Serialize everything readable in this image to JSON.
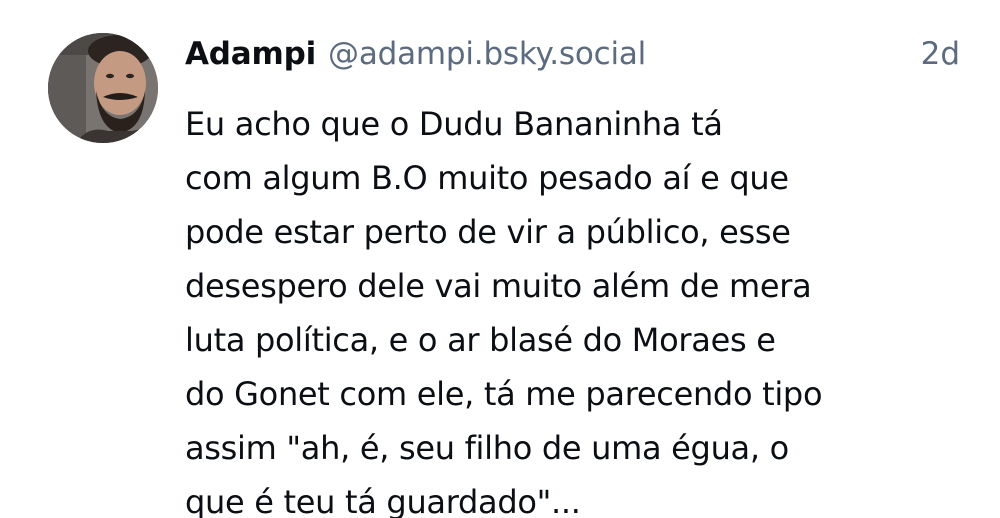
{
  "post": {
    "author": {
      "display_name": "Adampi",
      "handle": "@adampi.bsky.social",
      "avatar_icon": "user-avatar-photo"
    },
    "timestamp": "2d",
    "text_lines": [
      "Eu acho que o Dudu Bananinha tá",
      "com algum B.O muito pesado aí e que",
      "pode estar perto de vir a público, esse",
      "desespero dele vai muito além de mera",
      "luta política, e o ar blasé do Moraes e",
      "do Gonet com ele, tá me parecendo tipo",
      "assim \"ah, é, seu filho de uma égua, o",
      "que é teu tá guardado\"..."
    ]
  },
  "colors": {
    "background": "#ffffff",
    "text_primary": "#0b0f14",
    "text_secondary": "#5c6b7f"
  }
}
